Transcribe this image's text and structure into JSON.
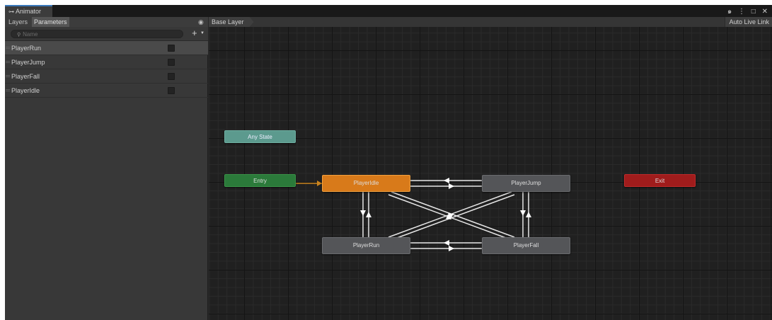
{
  "window": {
    "tab_title": "Animator",
    "tab_glyph": "⊶",
    "controls": "๑ ⋮ □ ✕"
  },
  "left_panel": {
    "tabs": [
      "Layers",
      "Parameters"
    ],
    "active_tab": "Parameters",
    "search": {
      "placeholder": "Name",
      "value": ""
    },
    "add_label": "+",
    "parameters": [
      {
        "name": "PlayerRun",
        "type": "bool",
        "value": false,
        "selected": true
      },
      {
        "name": "PlayerJump",
        "type": "bool",
        "value": false,
        "selected": false
      },
      {
        "name": "PlayerFall",
        "type": "bool",
        "value": false,
        "selected": false
      },
      {
        "name": "PlayerIdle",
        "type": "bool",
        "value": false,
        "selected": false
      }
    ]
  },
  "graph": {
    "breadcrumb": "Base Layer",
    "live_link_label": "Auto Live Link",
    "states": {
      "any": "Any State",
      "entry": "Entry",
      "exit": "Exit",
      "idle": "PlayerIdle",
      "jump": "PlayerJump",
      "run": "PlayerRun",
      "fall": "PlayerFall"
    },
    "default_state": "PlayerIdle",
    "colors": {
      "any_state": "#5c9a8e",
      "entry": "#2b7a3a",
      "exit": "#a01c1c",
      "default_state": "#d87a1a",
      "state": "#545558",
      "default_transition": "#c8831e",
      "transition": "#e6e6e6"
    }
  }
}
